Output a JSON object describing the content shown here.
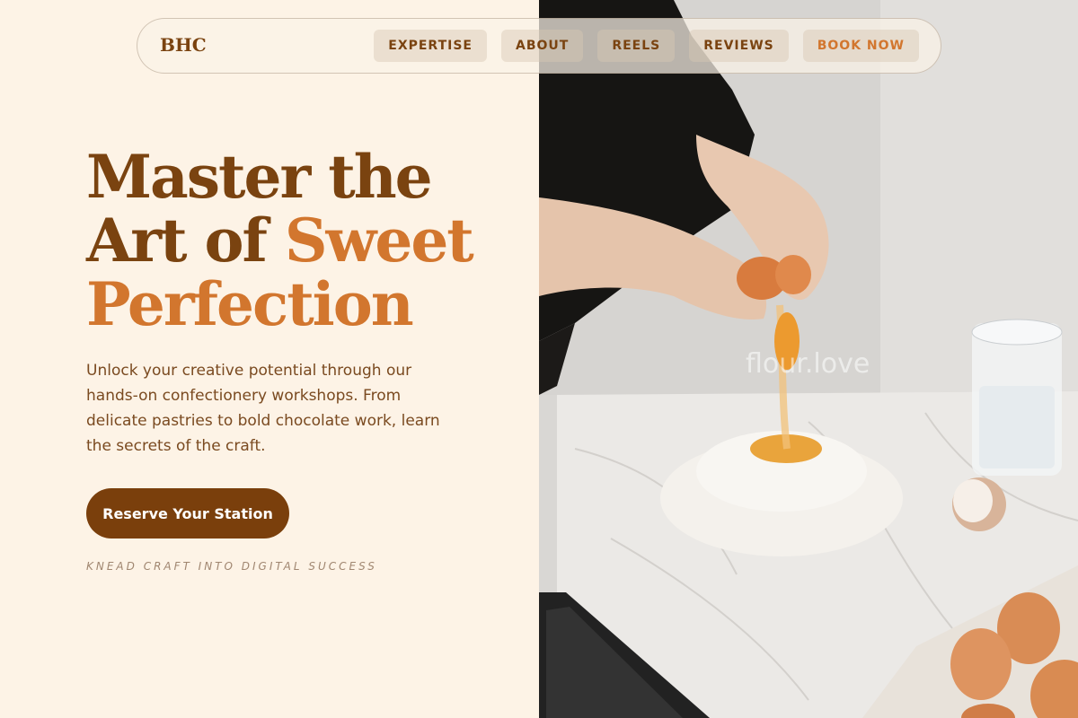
{
  "nav": {
    "brand": "BHC",
    "links": [
      {
        "label": "EXPERTISE"
      },
      {
        "label": "ABOUT"
      },
      {
        "label": "REELS"
      },
      {
        "label": "REVIEWS"
      },
      {
        "label": "BOOK NOW"
      }
    ]
  },
  "hero": {
    "headline_line1": "Master the",
    "headline_line2a": "Art of ",
    "headline_line2b": "Sweet",
    "headline_line3": "Perfection",
    "lead": "Unlock your creative potential through our hands-on confectionery workshops. From delicate pastries to bold chocolate work, learn the secrets of the craft.",
    "cta_label": "Reserve Your Station",
    "tagline": "KNEAD CRAFT INTO DIGITAL SUCCESS"
  },
  "photo": {
    "watermark": "flour.love"
  },
  "colors": {
    "background": "#fdf3e6",
    "brand_brown": "#7a4310",
    "accent_orange": "#d2762e",
    "button_brown": "#7a3f0c"
  }
}
